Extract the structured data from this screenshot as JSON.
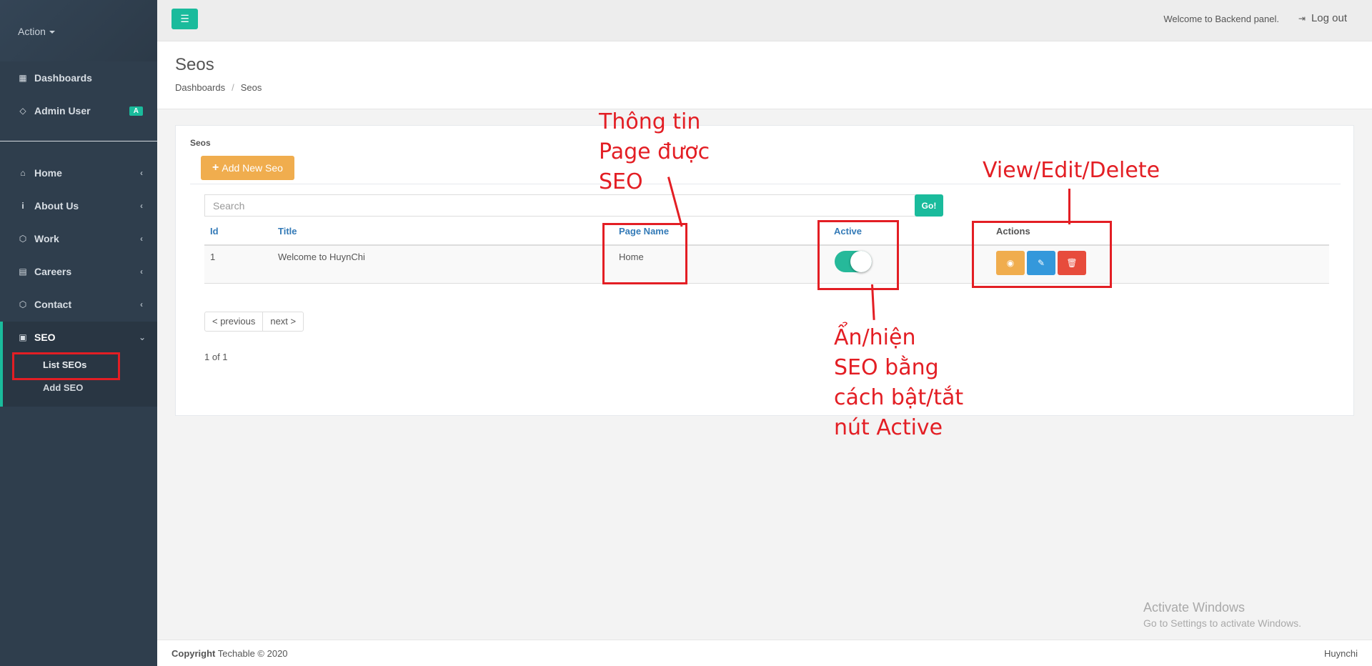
{
  "sidebar": {
    "action_label": "Action",
    "items": [
      {
        "label": "Dashboards",
        "icon": "dashboard-icon"
      },
      {
        "label": "Admin User",
        "icon": "diamond-icon",
        "badge": "A"
      },
      {
        "label": "Home",
        "icon": "home-icon"
      },
      {
        "label": "About Us",
        "icon": "info-icon"
      },
      {
        "label": "Work",
        "icon": "cube-icon"
      },
      {
        "label": "Careers",
        "icon": "id-card-icon"
      },
      {
        "label": "Contact",
        "icon": "cube-icon"
      },
      {
        "label": "SEO",
        "icon": "seo-icon"
      }
    ],
    "seo_sub": [
      "List SEOs",
      "Add SEO"
    ]
  },
  "topbar": {
    "welcome": "Welcome to Backend panel.",
    "logout": "Log out"
  },
  "page": {
    "title": "Seos",
    "breadcrumb": [
      "Dashboards",
      "Seos"
    ]
  },
  "panel": {
    "title": "Seos",
    "add_button": "Add New Seo",
    "search_placeholder": "Search",
    "go_button": "Go!",
    "headers": [
      "Id",
      "Title",
      "Page Name",
      "Active",
      "Actions"
    ],
    "rows": [
      {
        "id": "1",
        "title": "Welcome to HuynChi",
        "page_name": "Home",
        "active": true
      }
    ],
    "pager": [
      "< previous",
      "next >"
    ],
    "page_count": "1 of 1"
  },
  "footer": {
    "copyright_bold": "Copyright",
    "copyright_rest": " Techable © 2020",
    "right": "Huynchi"
  },
  "watermark": {
    "line1": "Activate Windows",
    "line2": "Go to Settings to activate Windows."
  },
  "annotations": {
    "page_info": [
      "Thông tin",
      "Page được",
      "SEO"
    ],
    "actions": "View/Edit/Delete",
    "toggle": [
      "Ẩn/hiện",
      "SEO bằng",
      "cách bật/tắt",
      "nút Active"
    ]
  },
  "colors": {
    "accent": "#1abb9c",
    "sidebar": "#2f3e4d",
    "warning": "#f0ad4e",
    "info": "#3498db",
    "danger": "#e74c3c",
    "annotation": "#e31e24"
  }
}
